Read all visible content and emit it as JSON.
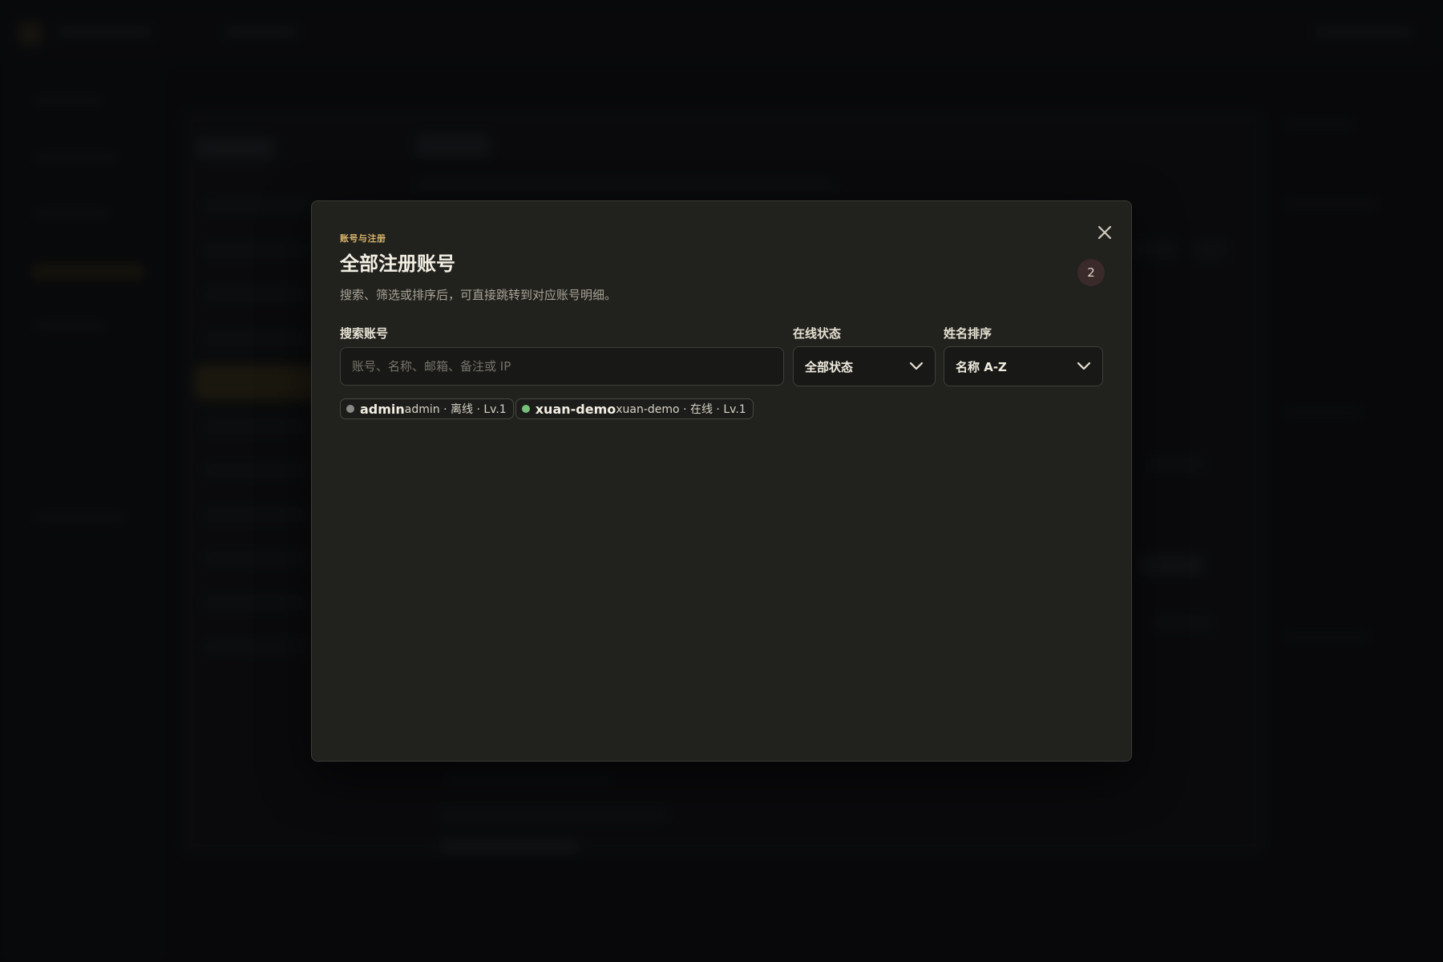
{
  "modal": {
    "eyebrow": "账号与注册",
    "title": "全部注册账号",
    "subtitle": "搜索、筛选或排序后，可直接跳转到对应账号明细。",
    "count": "2",
    "search": {
      "label": "搜索账号",
      "placeholder": "账号、名称、邮箱、备注或 IP",
      "value": ""
    },
    "status_filter": {
      "label": "在线状态",
      "selected": "全部状态"
    },
    "sort": {
      "label": "姓名排序",
      "selected": "名称 A-Z"
    },
    "accounts": [
      {
        "name": "admin",
        "meta": "admin · 离线 · Lv.1",
        "status": "offline"
      },
      {
        "name": "xuan-demo",
        "meta": "xuan-demo · 在线 · Lv.1",
        "status": "online"
      }
    ]
  },
  "colors": {
    "accent": "#d7b46a",
    "online": "#74c27a",
    "offline": "#8a8a85",
    "modal_bg": "#21211e"
  },
  "icons": {
    "close": "close-icon",
    "dropdown": "chevron-down-icon"
  }
}
